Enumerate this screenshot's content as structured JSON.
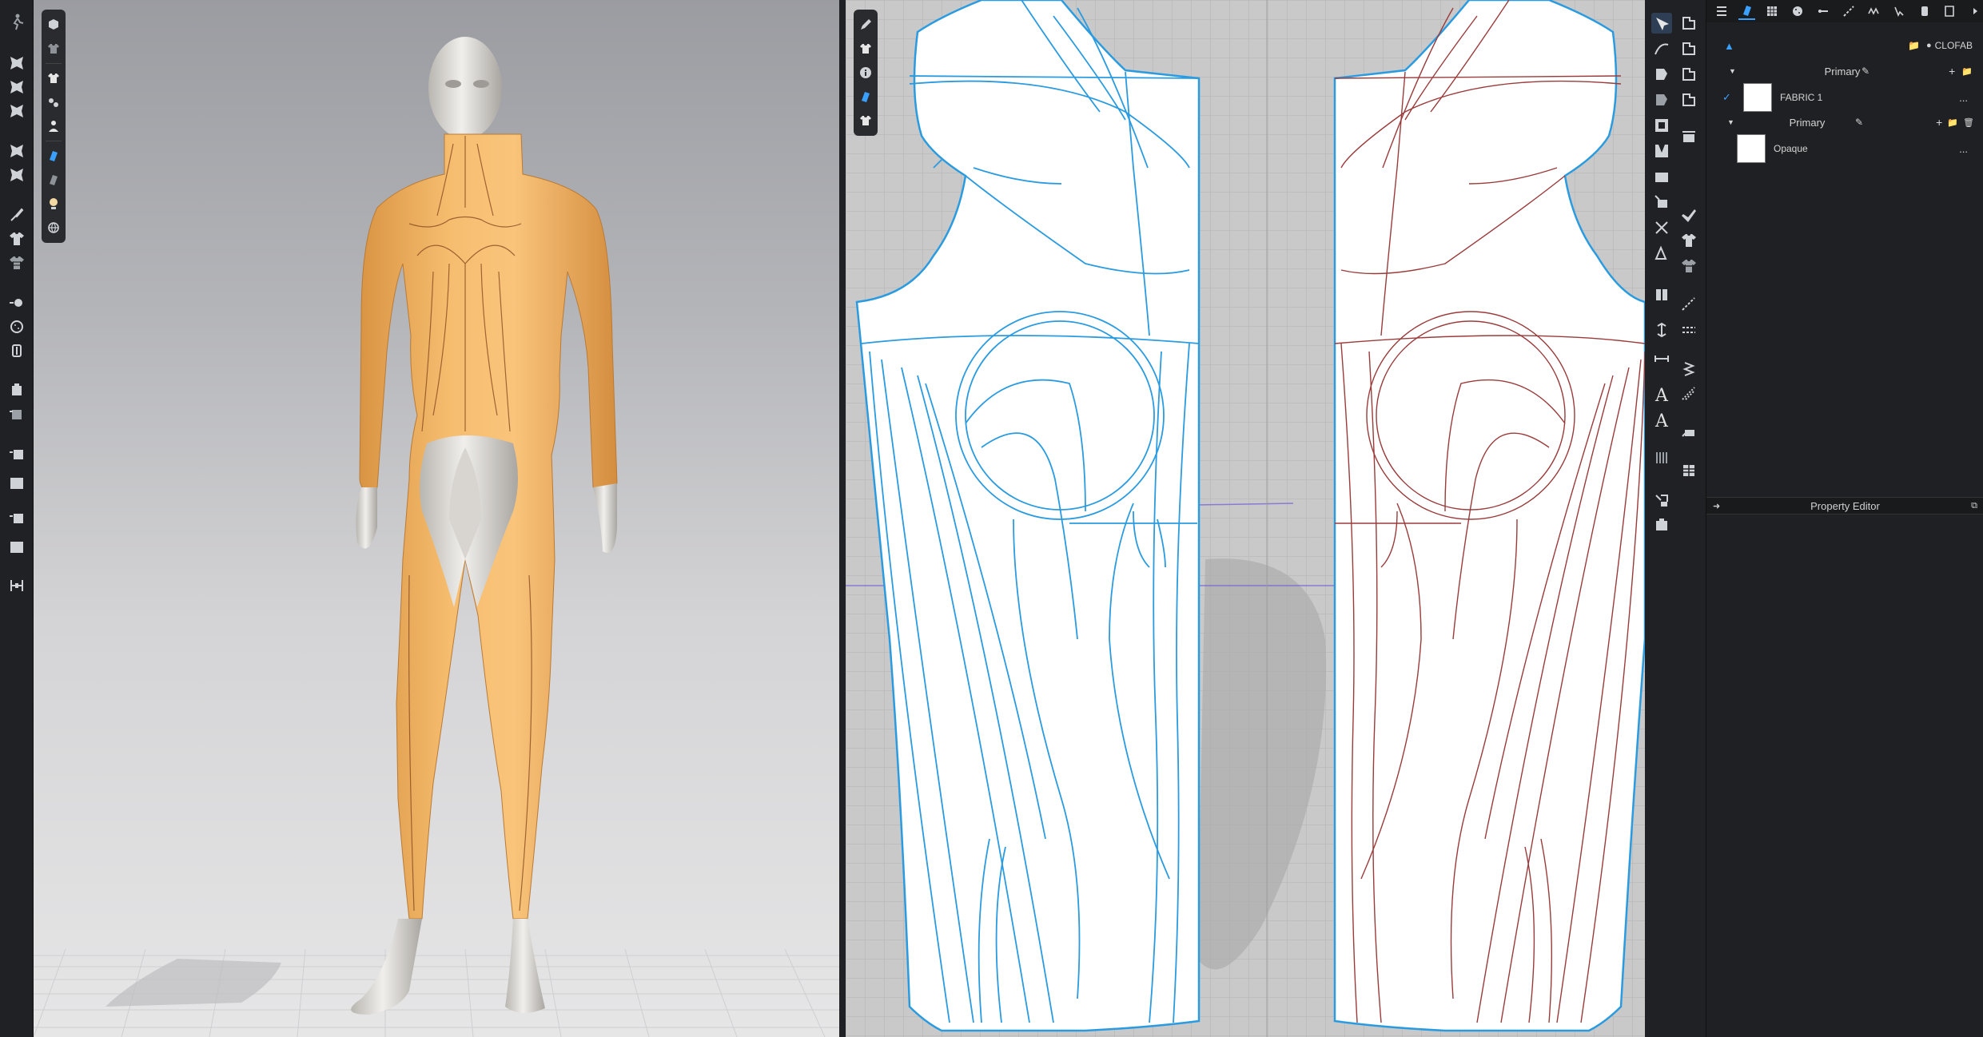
{
  "browser": {
    "brand": "CLOFAB",
    "group1": "Primary",
    "fabric1": "FABRIC 1",
    "group2": "Primary",
    "material": "Opaque",
    "more": "...",
    "property_editor": "Property Editor"
  },
  "colors": {
    "garment": "#f3b467",
    "seam_2d_left": "#2a9be0",
    "seam_2d_right": "#9a3b3b",
    "accent": "#3aa0ff"
  }
}
